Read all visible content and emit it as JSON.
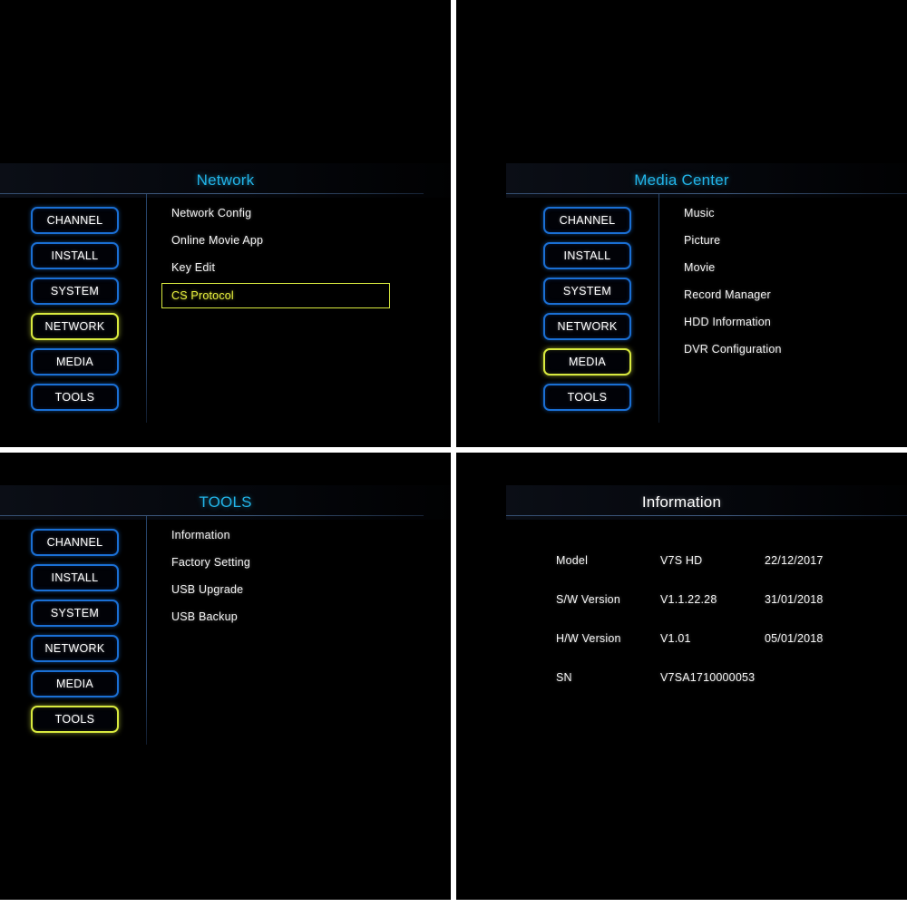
{
  "theme": {
    "panel_bg": "#000000",
    "title_cyan": "#22b4e8",
    "title_white": "#ffffff",
    "nav_border_blue": "#1a6fd4",
    "highlight_yellow": "#d9ea3f",
    "text_white": "#f2f2f2",
    "divider_white": "#ffffff"
  },
  "nav_items": [
    {
      "label": "CHANNEL"
    },
    {
      "label": "INSTALL"
    },
    {
      "label": "SYSTEM"
    },
    {
      "label": "NETWORK"
    },
    {
      "label": "MEDIA"
    },
    {
      "label": "TOOLS"
    }
  ],
  "panels": {
    "network": {
      "title": "Network",
      "selected_nav": "NETWORK",
      "items": [
        {
          "label": "Network Config",
          "selected": false
        },
        {
          "label": "Online Movie App",
          "selected": false
        },
        {
          "label": "Key Edit",
          "selected": false
        },
        {
          "label": "CS Protocol",
          "selected": true
        }
      ]
    },
    "media": {
      "title": "Media Center",
      "selected_nav": "MEDIA",
      "items": [
        {
          "label": "Music",
          "selected": false
        },
        {
          "label": "Picture",
          "selected": false
        },
        {
          "label": "Movie",
          "selected": false
        },
        {
          "label": "Record Manager",
          "selected": false
        },
        {
          "label": "HDD Information",
          "selected": false
        },
        {
          "label": "DVR Configuration",
          "selected": false
        }
      ]
    },
    "tools": {
      "title": "TOOLS",
      "selected_nav": "TOOLS",
      "items": [
        {
          "label": "Information",
          "selected": false
        },
        {
          "label": "Factory Setting",
          "selected": false
        },
        {
          "label": "USB Upgrade",
          "selected": false
        },
        {
          "label": "USB Backup",
          "selected": false
        }
      ]
    },
    "information": {
      "title": "Information",
      "rows": [
        {
          "label": "Model",
          "value": "V7S HD",
          "date": "22/12/2017"
        },
        {
          "label": "S/W Version",
          "value": "V1.1.22.28",
          "date": "31/01/2018"
        },
        {
          "label": "H/W Version",
          "value": "V1.01",
          "date": "05/01/2018"
        },
        {
          "label": "SN",
          "value": "V7SA1710000053",
          "date": ""
        }
      ]
    }
  }
}
